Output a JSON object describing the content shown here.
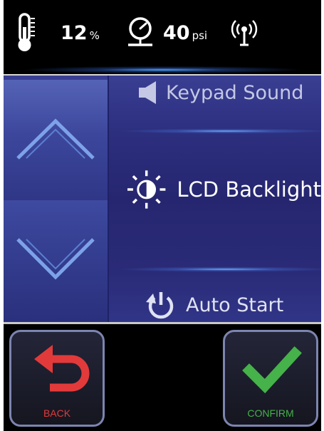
{
  "status": {
    "humidity_value": "12",
    "humidity_unit": "%",
    "pressure_value": "40",
    "pressure_unit": "psi",
    "icons": [
      "thermometer-icon",
      "pressure-gauge-icon",
      "wireless-signal-icon"
    ]
  },
  "menu": {
    "options": [
      {
        "label": "Keypad Sound",
        "icon": "speaker-icon"
      },
      {
        "label": "LCD Backlight",
        "icon": "brightness-icon",
        "selected": true
      },
      {
        "label": "Auto Start",
        "icon": "power-restart-icon"
      }
    ],
    "arrows": [
      "chevron-up-icon",
      "chevron-down-icon"
    ]
  },
  "buttons": {
    "back_label": "BACK",
    "confirm_label": "CONFIRM"
  },
  "colors": {
    "back": "#e23a3a",
    "confirm": "#45b24a",
    "panel": "#2a2b78",
    "arrow": "#6b8cd6"
  }
}
